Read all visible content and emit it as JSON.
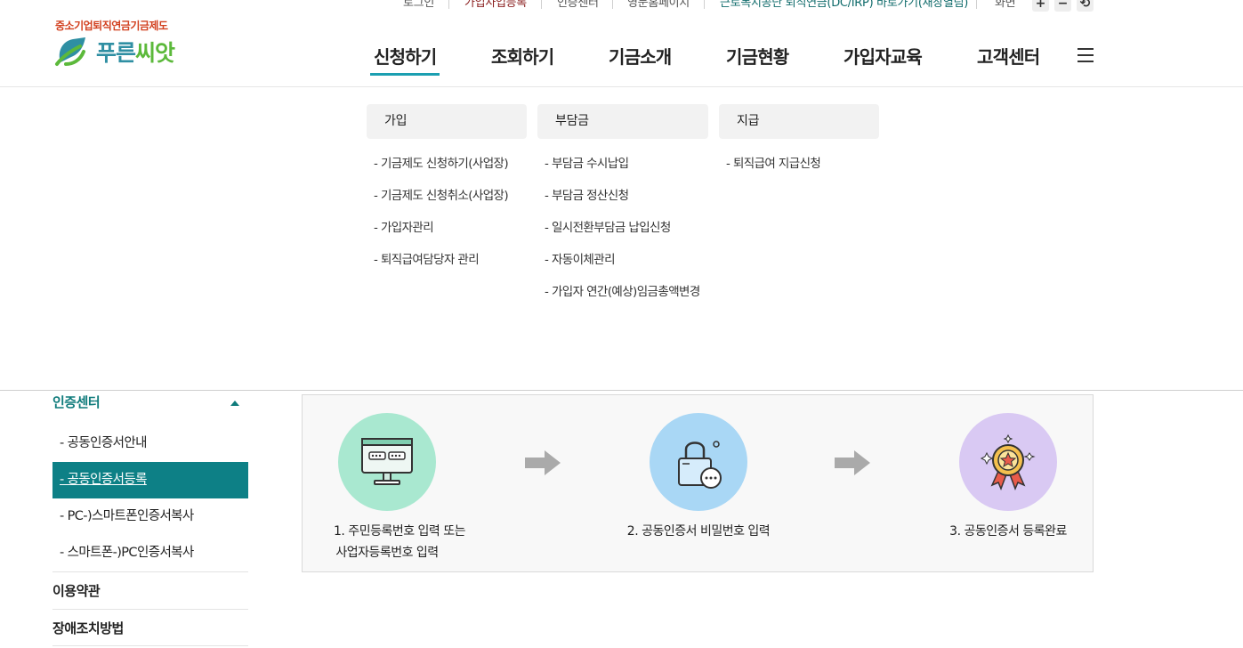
{
  "util_bar": {
    "login": "로그인",
    "join": "가입사업등록",
    "cert_center": "인증센터",
    "english": "영문홈페이지",
    "kcomwel": "근로복지공단 퇴직연금(DC/IRP) 바로가기(새창열림)",
    "screen": "화면",
    "zoom_in": "+",
    "zoom_out": "−",
    "reset": "⟲"
  },
  "logo": {
    "tagline": "중소기업퇴직연금기금제도",
    "name_part1": "푸른",
    "name_part2": "씨앗"
  },
  "gnb": {
    "items": [
      "신청하기",
      "조회하기",
      "기금소개",
      "기금현황",
      "가입자교육",
      "고객센터"
    ],
    "active_index": 0
  },
  "mega_menu": {
    "columns": [
      {
        "title": "가입",
        "links": [
          "- 기금제도 신청하기(사업장)",
          "- 기금제도 신청취소(사업장)",
          "- 가입자관리",
          "- 퇴직급여담당자 관리"
        ]
      },
      {
        "title": "부담금",
        "links": [
          "- 부담금 수시납입",
          "- 부담금 정산신청",
          "- 일시전환부담금 납입신청",
          "- 자동이체관리",
          "- 가입자 연간(예상)임금총액변경"
        ]
      },
      {
        "title": "지급",
        "links": [
          "- 퇴직급여 지급신청"
        ]
      }
    ]
  },
  "side_nav": {
    "title": "인증센터",
    "sub_items": [
      "-  공동인증서안내",
      "-  공동인증서등록",
      "-  PC-)스마트폰인증서복사",
      "-  스마트폰-)PC인증서복사"
    ],
    "active_index": 1,
    "terms": "이용약관",
    "accessibility": "장애조치방법"
  },
  "process": {
    "steps": [
      {
        "line1": "1. 주민등록번호 입력 또는",
        "line2": "사업자등록번호 입력",
        "icon": "monitor-icon",
        "color": "#a9e8d0"
      },
      {
        "line1": "2. 공동인증서 비밀번호 입력",
        "line2": "",
        "icon": "lock-icon",
        "color": "#a9d7f5"
      },
      {
        "line1": "3. 공동인증서 등록완료",
        "line2": "",
        "icon": "medal-icon",
        "color": "#d9c9f3"
      }
    ],
    "arrow_color": "#aaaaaa"
  },
  "colors": {
    "accent": "#1b9fb1",
    "side_active": "#0d8086",
    "brand_green": "#5cb93b",
    "brand_blue": "#2f8fa3",
    "tagline_red": "#d2401f"
  }
}
